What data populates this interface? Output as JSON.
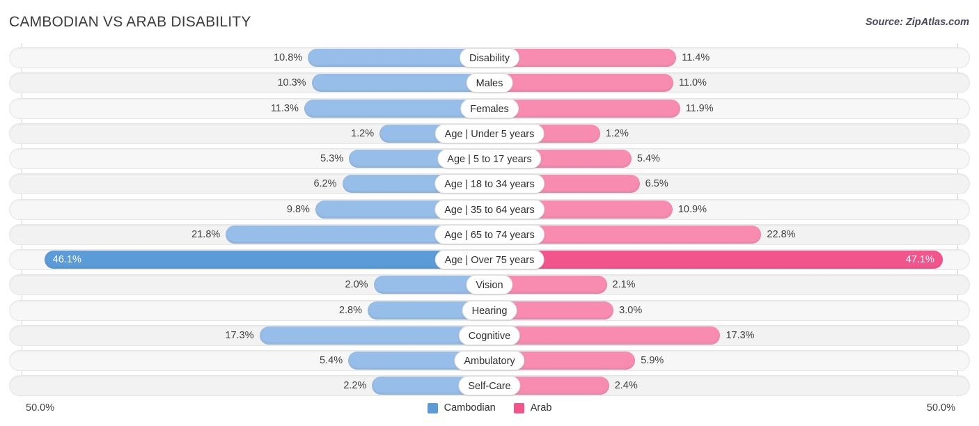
{
  "header": {
    "title": "CAMBODIAN VS ARAB DISABILITY",
    "source": "Source: ZipAtlas.com"
  },
  "axis": {
    "left_tick": "50.0%",
    "right_tick": "50.0%",
    "max_percent": 50.0
  },
  "legend": {
    "items": [
      {
        "label": "Cambodian",
        "color": "#5b9bd8"
      },
      {
        "label": "Arab",
        "color": "#f2558c"
      }
    ]
  },
  "colors": {
    "left_bar": "#96bee8",
    "right_bar": "#f78cb0",
    "left_bar_max": "#5b9bd8",
    "right_bar_max": "#f2558c",
    "track": "#f7f7f7",
    "text": "#3f3f3f"
  },
  "chart_data": {
    "type": "bar",
    "subtype": "diverging-bidirectional",
    "title": "CAMBODIAN VS ARAB DISABILITY",
    "xlabel": "",
    "ylabel": "",
    "xlim": [
      -50.0,
      50.0
    ],
    "grid": false,
    "legend_position": "bottom-center",
    "categories": [
      "Disability",
      "Males",
      "Females",
      "Age | Under 5 years",
      "Age | 5 to 17 years",
      "Age | 18 to 34 years",
      "Age | 35 to 64 years",
      "Age | 65 to 74 years",
      "Age | Over 75 years",
      "Vision",
      "Hearing",
      "Cognitive",
      "Ambulatory",
      "Self-Care"
    ],
    "series": [
      {
        "name": "Cambodian",
        "side": "left",
        "values": [
          10.8,
          10.3,
          11.3,
          1.2,
          5.3,
          6.2,
          9.8,
          21.8,
          46.1,
          2.0,
          2.8,
          17.3,
          5.4,
          2.2
        ],
        "labels": [
          "10.8%",
          "10.3%",
          "11.3%",
          "1.2%",
          "5.3%",
          "6.2%",
          "9.8%",
          "21.8%",
          "46.1%",
          "2.0%",
          "2.8%",
          "17.3%",
          "5.4%",
          "2.2%"
        ]
      },
      {
        "name": "Arab",
        "side": "right",
        "values": [
          11.4,
          11.0,
          11.9,
          1.2,
          5.4,
          6.5,
          10.9,
          22.8,
          47.1,
          2.1,
          3.0,
          17.3,
          5.9,
          2.4
        ],
        "labels": [
          "11.4%",
          "11.0%",
          "11.9%",
          "1.2%",
          "5.4%",
          "6.5%",
          "10.9%",
          "22.8%",
          "47.1%",
          "2.1%",
          "3.0%",
          "17.3%",
          "5.9%",
          "2.4%"
        ]
      }
    ]
  }
}
